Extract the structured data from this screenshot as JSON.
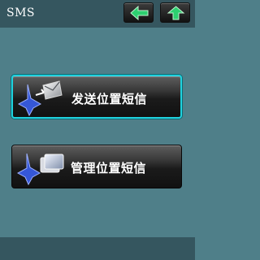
{
  "header": {
    "title": "SMS",
    "back_icon": "arrow-left-icon",
    "up_icon": "arrow-up-icon"
  },
  "menu": {
    "items": [
      {
        "label": "发送位置短信",
        "icon": "send-location-sms-icon",
        "selected": true
      },
      {
        "label": "管理位置短信",
        "icon": "manage-location-sms-icon",
        "selected": false
      }
    ]
  },
  "colors": {
    "background": "#4f7f89",
    "title_bar": "#35565f",
    "accent": "#20d2de",
    "arrow_green": "#2dd070",
    "button_dark": "#111111"
  }
}
